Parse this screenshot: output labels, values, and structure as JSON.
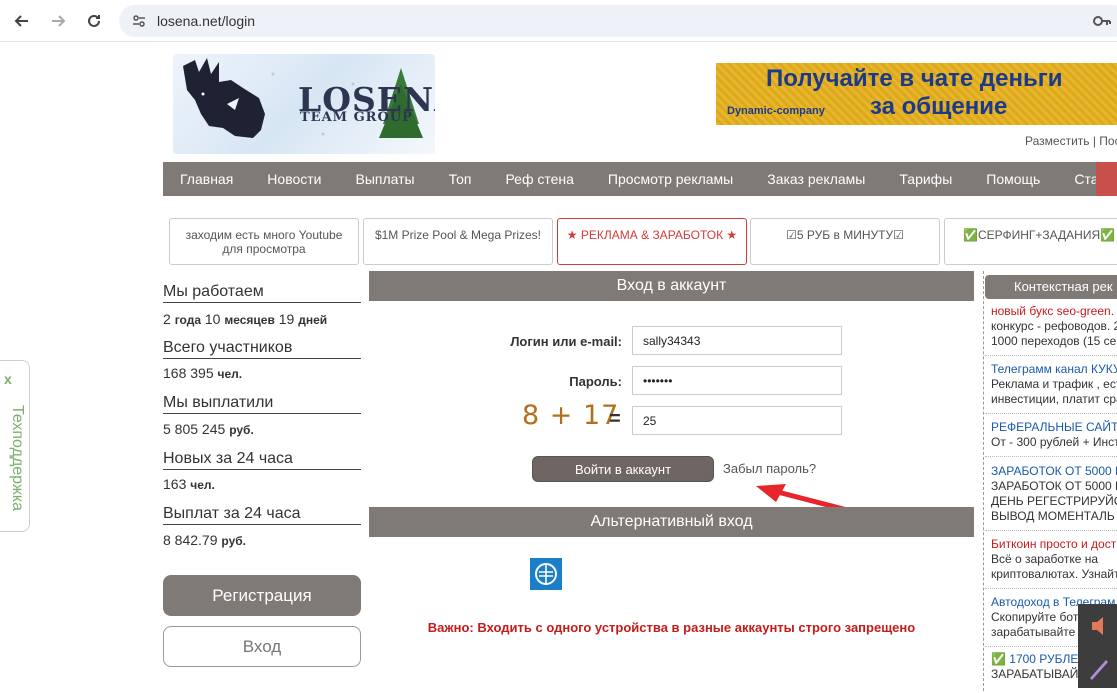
{
  "browser": {
    "url": "losena.net/login",
    "back_icon": "arrow-left-icon",
    "forward_icon": "arrow-right-icon",
    "reload_icon": "reload-icon"
  },
  "header": {
    "logo_title": "LOSENA",
    "logo_subtitle": "TEAM GROUP",
    "banner_line1": "Получайте в чате деньги",
    "banner_line2": "за общение",
    "banner_company": "Dynamic-company",
    "banner_links": "Разместить | Пос"
  },
  "menu": {
    "items": [
      "Главная",
      "Новости",
      "Выплаты",
      "Топ",
      "Реф стена",
      "Просмотр рекламы",
      "Заказ рекламы",
      "Тарифы",
      "Помощь",
      "Статьи"
    ]
  },
  "tabs": [
    {
      "line1": "заходим есть много Youtube",
      "line2": "для просмотра"
    },
    {
      "line1": "$1M Prize Pool & Mega Prizes!",
      "line2": ""
    },
    {
      "line1": "★ РЕКЛАМА & ЗАРАБОТОК ★",
      "line2": ""
    },
    {
      "line1": "☑5 РУБ в МИНУТУ☑",
      "line2": ""
    },
    {
      "line1": "✅СЕРФИНГ+ЗАДАНИЯ✅",
      "line2": ""
    }
  ],
  "stats": {
    "working_label": "Мы работаем",
    "working_years": "2",
    "working_years_unit": "года",
    "working_months": "10",
    "working_months_unit": "месяцев",
    "working_days": "19",
    "working_days_unit": "дней",
    "members_label": "Всего участников",
    "members_value": "168 395",
    "members_unit": "чел.",
    "paid_label": "Мы выплатили",
    "paid_value": "5 805 245",
    "paid_unit": "руб.",
    "new24_label": "Новых за 24 часа",
    "new24_value": "163",
    "new24_unit": "чел.",
    "payouts24_label": "Выплат за 24 часа",
    "payouts24_value": "8 842.79",
    "payouts24_unit": "руб."
  },
  "side_buttons": {
    "register": "Регистрация",
    "login": "Вход"
  },
  "login": {
    "title": "Вход в аккаунт",
    "login_label": "Логин или e-mail:",
    "login_value": "sally34343",
    "password_label": "Пароль:",
    "password_value": "•••••••",
    "captcha": "8 + 17",
    "equals": "=",
    "captcha_answer": "25",
    "submit": "Войти в аккаунт",
    "forgot": "Забыл пароль?",
    "alt_title": "Альтернативный вход",
    "warning": "Важно: Входить с одного устройства в разные аккаунты строго запрещено"
  },
  "context_ads": {
    "title": "Контекстная рек",
    "items": [
      {
        "title": "новый букс seo-green.",
        "desc1": "конкурс - рефоводов. 2",
        "desc2": "1000 переходов (15 сек",
        "red": true
      },
      {
        "title": "Телеграмм канал КУКУ",
        "desc1": "Реклама и трафик , ест",
        "desc2": "инвестиции, платит сра",
        "red": false
      },
      {
        "title": "РЕФЕРАЛЬНЫЕ САЙТ",
        "desc1": "От - 300 рублей + Инст",
        "desc2": "",
        "red": false
      },
      {
        "title": "ЗАРАБОТОК ОТ 5000 Р",
        "desc1": "ЗАРАБОТОК ОТ 5000 Р",
        "desc2": "ДЕНЬ РЕГЕСТРИРУЙС",
        "desc3": "ВЫВОД МОМЕНТАЛЬ",
        "red": false
      },
      {
        "title": "Биткоин просто и дост",
        "desc1": "Всё о заработке на",
        "desc2": "криптовалютах. Узнайт",
        "red": true
      },
      {
        "title": "Автодоход в Телеграм",
        "desc1": "Скопируйте бот",
        "desc2": "зарабатывайте",
        "red": false
      },
      {
        "title": "✅ 1700 РУБЛЕ",
        "desc1": "ЗАРАБАТЫВАЙ",
        "desc2": "",
        "red": false
      }
    ]
  },
  "support": {
    "close": "x",
    "label": "Техподдержка"
  }
}
